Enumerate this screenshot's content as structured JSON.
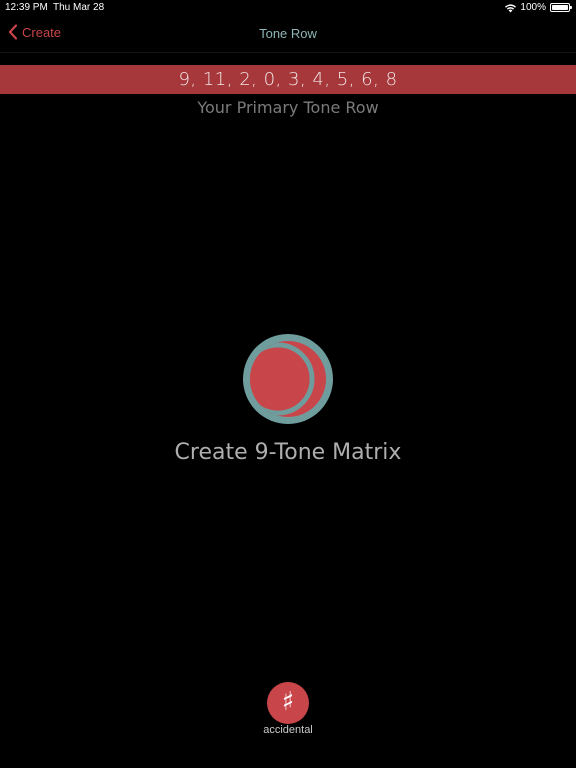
{
  "status_bar": {
    "time": "12:39 PM",
    "date": "Thu Mar 28",
    "battery": "100%",
    "wifi_icon": "wifi-icon",
    "battery_icon": "battery-full-icon"
  },
  "nav": {
    "back_label": "Create",
    "back_icon": "chevron-left-icon",
    "title": "Tone Row"
  },
  "tone_row": {
    "values": "9, 11, 2, 0, 3, 4, 5, 6, 8",
    "subtitle": "Your Primary Tone Row"
  },
  "matrix": {
    "icon": "moon-circle-icon",
    "label": "Create 9-Tone Matrix"
  },
  "accidental": {
    "symbol": "♯",
    "label": "accidental"
  },
  "colors": {
    "background": "#000000",
    "accent_red": "#c8454a",
    "banner_red": "#a6383b",
    "teal": "#6f9c9d"
  }
}
